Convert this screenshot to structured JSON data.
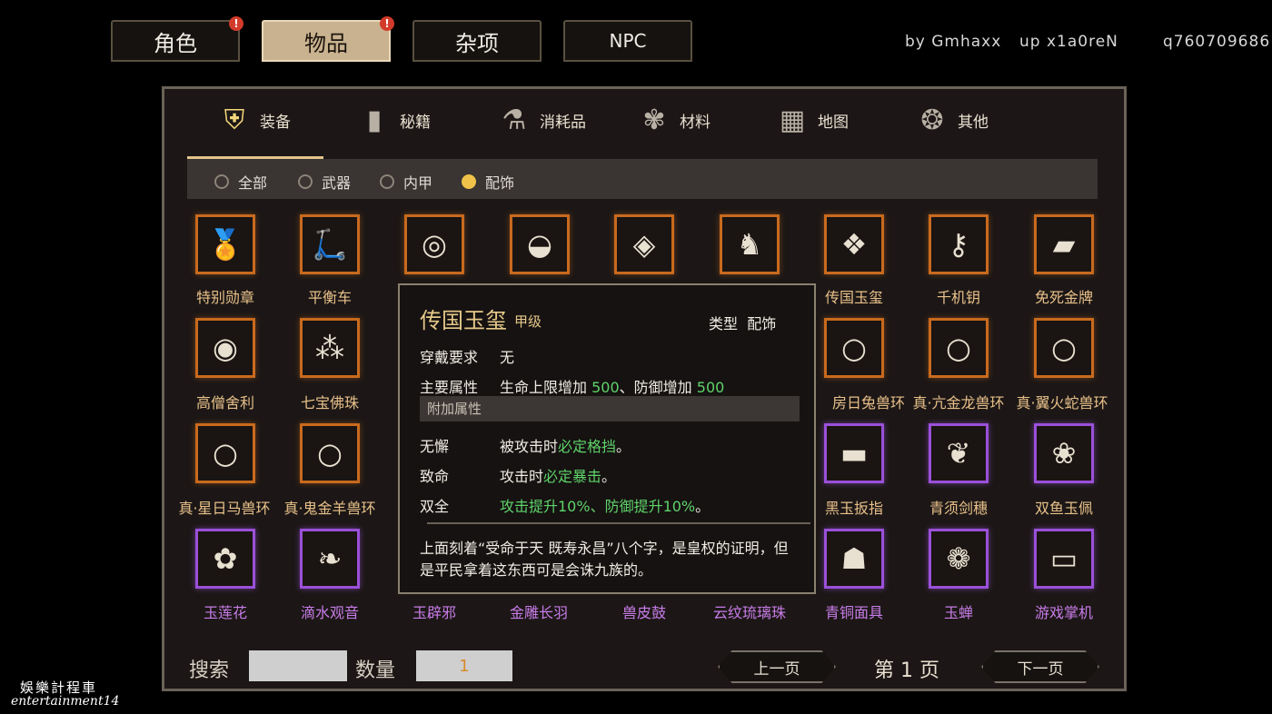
{
  "top_tabs": [
    {
      "label": "角色",
      "badge": "!"
    },
    {
      "label": "物品",
      "badge": "!"
    },
    {
      "label": "杂项"
    },
    {
      "label": "NPC"
    }
  ],
  "credits": {
    "by": "by Gmhaxx",
    "up": "up x1a0reN",
    "q": "q760709686"
  },
  "categories": [
    "装备",
    "秘籍",
    "消耗品",
    "材料",
    "地图",
    "其他"
  ],
  "filters": [
    "全部",
    "武器",
    "内甲",
    "配饰"
  ],
  "items": [
    "特别勋章",
    "平衡车",
    "",
    "",
    "",
    "",
    "传国玉玺",
    "千机钥",
    "免死金牌",
    "高僧舍利",
    "七宝佛珠",
    "",
    "",
    "",
    "",
    "房日兔兽环",
    "真·亢金龙兽环",
    "真·翼火蛇兽环",
    "真·星日马兽环",
    "真·鬼金羊兽环",
    "",
    "",
    "",
    "",
    "黑玉扳指",
    "青须剑穗",
    "双鱼玉佩",
    "玉莲花",
    "滴水观音",
    "玉辟邪",
    "金雕长羽",
    "兽皮鼓",
    "云纹琉璃珠",
    "青铜面具",
    "玉蝉",
    "游戏掌机"
  ],
  "tooltip": {
    "title": "传国玉玺",
    "grade": "甲级",
    "type_label": "类型",
    "type_value": "配饰",
    "req_label": "穿戴要求",
    "req_value": "无",
    "main_label": "主要属性",
    "main_a": "生命上限增加",
    "main_a_val": "500",
    "main_b": "、防御增加",
    "main_b_val": "500",
    "extra_header": "附加属性",
    "extras": [
      {
        "name": "无懈",
        "pre": "被攻击时",
        "hl": "必定格挡",
        "post": "。"
      },
      {
        "name": "致命",
        "pre": "攻击时",
        "hl": "必定暴击",
        "post": "。"
      },
      {
        "name": "双全",
        "pre": "",
        "hl": "攻击提升10%、防御提升10%",
        "post": "。"
      }
    ],
    "description": "上面刻着“受命于天 既寿永昌”八个字，是皇权的证明，但是平民拿着这东西可是会诛九族的。"
  },
  "bottom": {
    "search_label": "搜索",
    "qty_label": "数量",
    "qty_value": "1",
    "prev": "上一页",
    "page": "第 1 页",
    "next": "下一页"
  },
  "watermark": {
    "line1": "娛樂計程車",
    "line2": "entertainment14"
  }
}
